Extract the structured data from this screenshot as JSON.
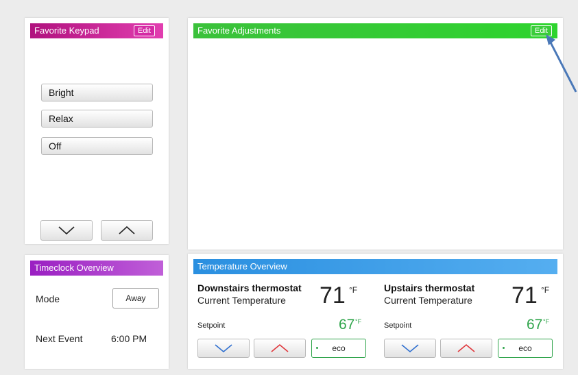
{
  "favorite_keypad": {
    "title": "Favorite Keypad",
    "edit_label": "Edit",
    "scenes": [
      "Bright",
      "Relax",
      "Off"
    ]
  },
  "favorite_adjustments": {
    "title": "Favorite Adjustments",
    "edit_label": "Edit"
  },
  "timeclock": {
    "title": "Timeclock Overview",
    "mode_label": "Mode",
    "mode_value": "Away",
    "next_event_label": "Next Event",
    "next_event_value": "6:00 PM"
  },
  "temperature": {
    "title": "Temperature Overview",
    "thermostats": [
      {
        "name": "Downstairs thermostat",
        "subtitle": "Current Temperature",
        "current": "71",
        "unit": "°F",
        "setpoint_label": "Setpoint",
        "setpoint": "67",
        "setpoint_unit": "°F",
        "eco_label": "eco"
      },
      {
        "name": "Upstairs thermostat",
        "subtitle": "Current Temperature",
        "current": "71",
        "unit": "°F",
        "setpoint_label": "Setpoint",
        "setpoint": "67",
        "setpoint_unit": "°F",
        "eco_label": "eco"
      }
    ]
  },
  "icons": {
    "down": "chevron-down-icon",
    "up": "chevron-up-icon",
    "annotation_arrow": "arrow-icon"
  },
  "colors": {
    "keypad_header": "#c21a92",
    "adjust_header": "#33c933",
    "timeclock_header": "#a836cc",
    "temperature_header": "#3a9ae8",
    "setpoint_green": "#2ea44a",
    "down_chevron": "#2f6fd0",
    "up_chevron": "#e0353a",
    "annotation_arrow": "#4a78b8"
  }
}
